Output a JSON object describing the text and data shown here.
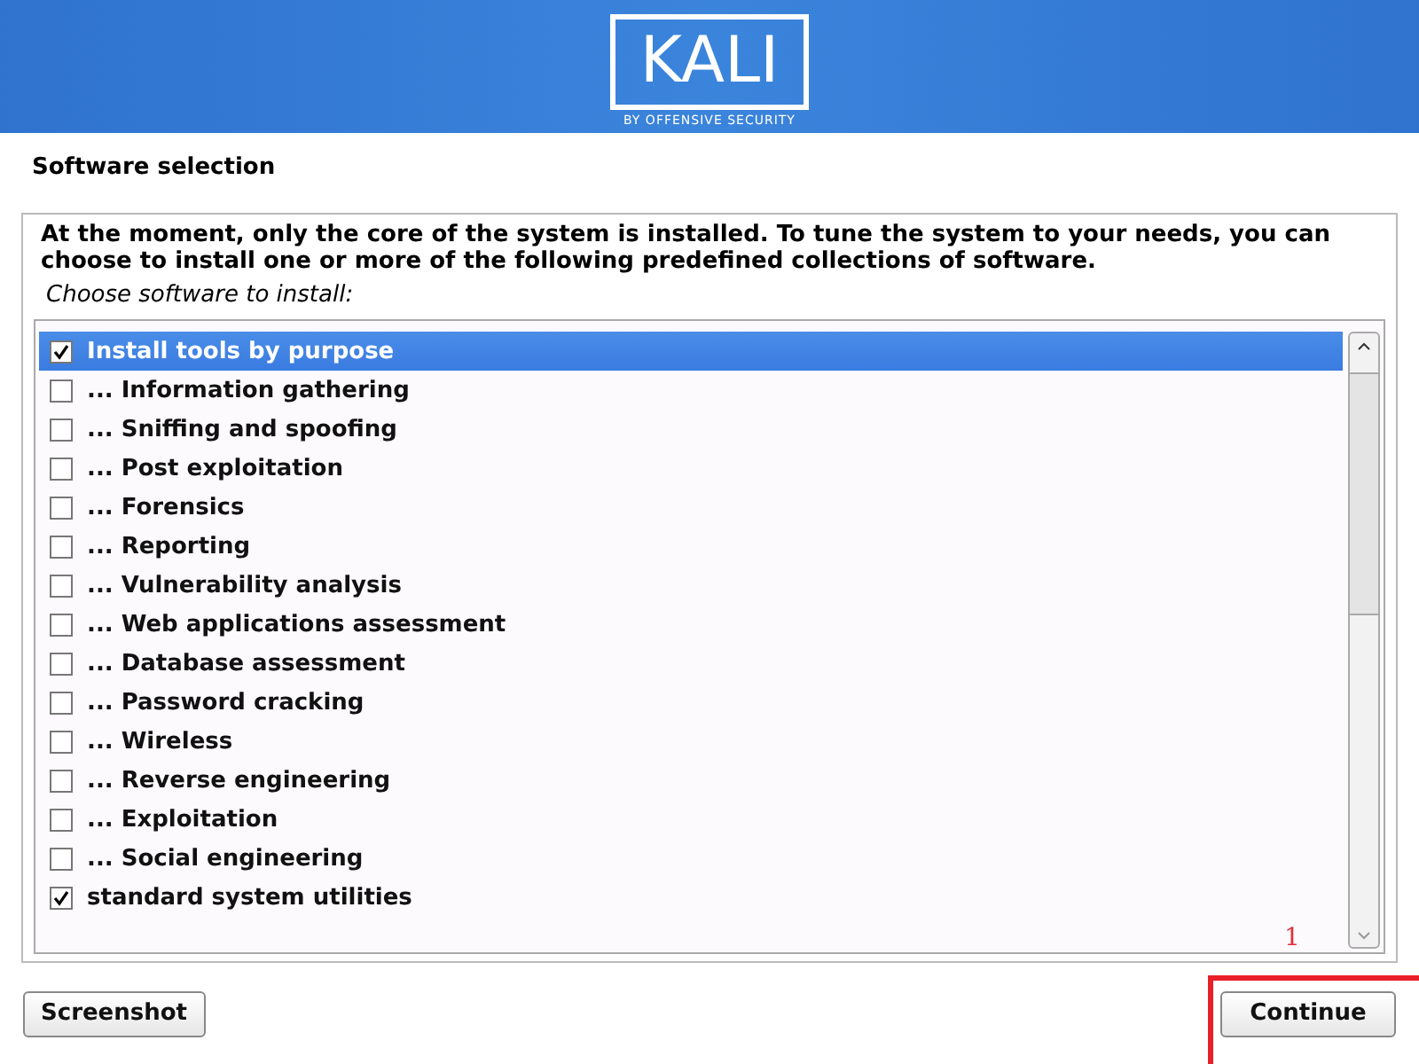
{
  "banner": {
    "logo": "KALI",
    "tagline": "BY OFFENSIVE SECURITY"
  },
  "title": "Software selection",
  "intro": "At the moment, only the core of the system is installed. To tune the system to your needs, you can choose to install one or more of the following predefined collections of software.",
  "prompt": "Choose software to install:",
  "items": [
    {
      "label": "Install tools by purpose",
      "checked": true,
      "selected": true
    },
    {
      "label": "... Information gathering",
      "checked": false,
      "selected": false
    },
    {
      "label": "... Sniffing and spoofing",
      "checked": false,
      "selected": false
    },
    {
      "label": "... Post exploitation",
      "checked": false,
      "selected": false
    },
    {
      "label": "... Forensics",
      "checked": false,
      "selected": false
    },
    {
      "label": "... Reporting",
      "checked": false,
      "selected": false
    },
    {
      "label": "... Vulnerability analysis",
      "checked": false,
      "selected": false
    },
    {
      "label": "... Web applications assessment",
      "checked": false,
      "selected": false
    },
    {
      "label": "... Database assessment",
      "checked": false,
      "selected": false
    },
    {
      "label": "... Password cracking",
      "checked": false,
      "selected": false
    },
    {
      "label": "... Wireless",
      "checked": false,
      "selected": false
    },
    {
      "label": "... Reverse engineering",
      "checked": false,
      "selected": false
    },
    {
      "label": "... Exploitation",
      "checked": false,
      "selected": false
    },
    {
      "label": "... Social engineering",
      "checked": false,
      "selected": false
    },
    {
      "label": "standard system utilities",
      "checked": true,
      "selected": false
    }
  ],
  "annotation": {
    "label": "1"
  },
  "buttons": [
    {
      "label": "Screenshot",
      "kind": "left"
    },
    {
      "label": "Continue",
      "kind": "right"
    }
  ]
}
